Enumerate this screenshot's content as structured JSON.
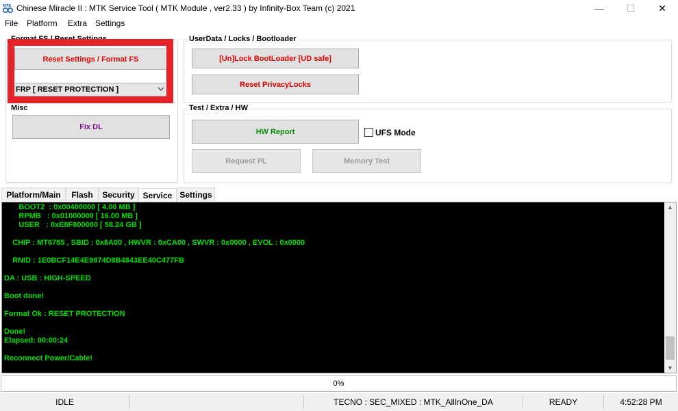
{
  "window": {
    "title": "Chinese Miracle II : MTK Service Tool ( MTK Module , ver2.33  ) by Infinity-Box Team (c) 2021",
    "minimize": "—",
    "maximize": "☐",
    "close": "✕"
  },
  "menu": [
    "File",
    "Platform",
    "Extra",
    "Settings"
  ],
  "format_group": {
    "title": "Format FS / Reset Settings",
    "reset_button": "Reset Settings / Format FS",
    "combo_value": "FRP [ RESET PROTECTION ]"
  },
  "misc_group": {
    "title": "Misc",
    "fix_dl_button": "Fix DL"
  },
  "userdata_group": {
    "title": "UserData /  Locks  / Bootloader",
    "unlock_button": "[Un]Lock BootLoader [UD safe]",
    "privacy_button": "Reset PrivacyLocks"
  },
  "test_group": {
    "title": "Test / Extra / HW",
    "hw_report_button": "HW Report",
    "ufs_mode_label": "UFS Mode",
    "ufs_mode_checked": false,
    "request_pl_button": "Request PL",
    "memory_test_button": "Memory Test"
  },
  "tabs": [
    "Platform/Main",
    "Flash",
    "Security",
    "Service",
    "Settings"
  ],
  "active_tab": "Service",
  "console": {
    "lines": [
      "       BOOT2  : 0x00400000 [ 4.00 MB ]",
      "       RPMB   : 0x01000000 [ 16.00 MB ]",
      "       USER   : 0xE8F800000 [ 58.24 GB ]",
      "",
      "    CHIP : MT6765 , SBID : 0x8A00 , HWVR : 0xCA00 , SWVR : 0x0000 , EVOL : 0x0000",
      "",
      "    RNID : 1E0BCF14E4E9874D8B4843EE40C477FB",
      "",
      "DA : USB : HIGH-SPEED",
      "",
      "Boot done!",
      "",
      "Format Ok : RESET PROTECTION",
      "",
      "Done!",
      "Elapsed: 00:00:24",
      "",
      "Reconnect Power/Cable!"
    ],
    "text_color": "#00e000"
  },
  "progress": {
    "label": "0%",
    "value": 0
  },
  "status": {
    "state": "IDLE",
    "device": "TECNO : SEC_MIXED : MTK_AllInOne_DA",
    "ready": "READY",
    "time": "4:52:28 PM"
  },
  "colors": {
    "highlight_frame": "#e8222b",
    "red_text": "#e00000",
    "green_text": "#0c8a0c",
    "purple_text": "#7b0e8e"
  }
}
